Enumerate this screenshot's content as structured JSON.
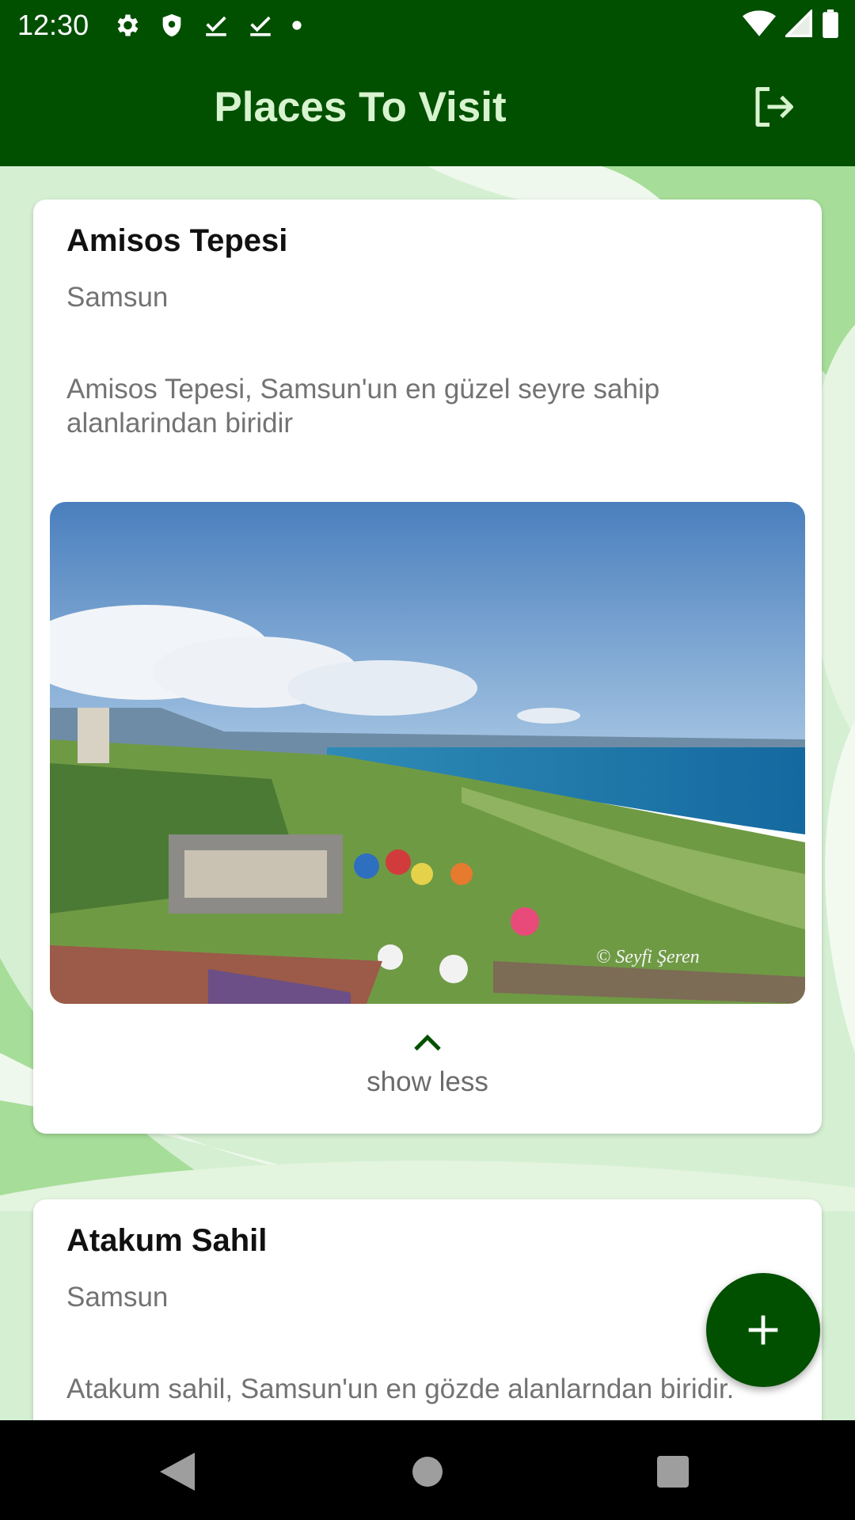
{
  "status_bar": {
    "time": "12:30",
    "left_icons": [
      "gear-icon",
      "shield-icon",
      "download-done-icon",
      "download-done-icon",
      "dot-icon"
    ],
    "right_icons": [
      "wifi-icon",
      "signal-icon",
      "battery-icon"
    ]
  },
  "app_bar": {
    "title": "Places To Visit",
    "logout_icon": "logout-icon"
  },
  "places": [
    {
      "title": "Amisos Tepesi",
      "city": "Samsun",
      "description": "Amisos Tepesi, Samsun'un en güzel seyre sahip alanlarindan biridir",
      "photo_watermark": "© Seyfi Şeren",
      "toggle_label": "show less",
      "expanded": true
    },
    {
      "title": "Atakum Sahil",
      "city": "Samsun",
      "description": "Atakum sahil, Samsun'un en gözde alanlarndan biridir."
    }
  ],
  "fab": {
    "icon": "plus-icon"
  },
  "nav_bar": {
    "icons": [
      "back-icon",
      "home-icon",
      "recents-icon"
    ]
  },
  "colors": {
    "primary": "#005000",
    "title_text": "#d8f3cf",
    "background": "#d5efd2",
    "card": "#ffffff",
    "secondary_text": "#737373"
  }
}
